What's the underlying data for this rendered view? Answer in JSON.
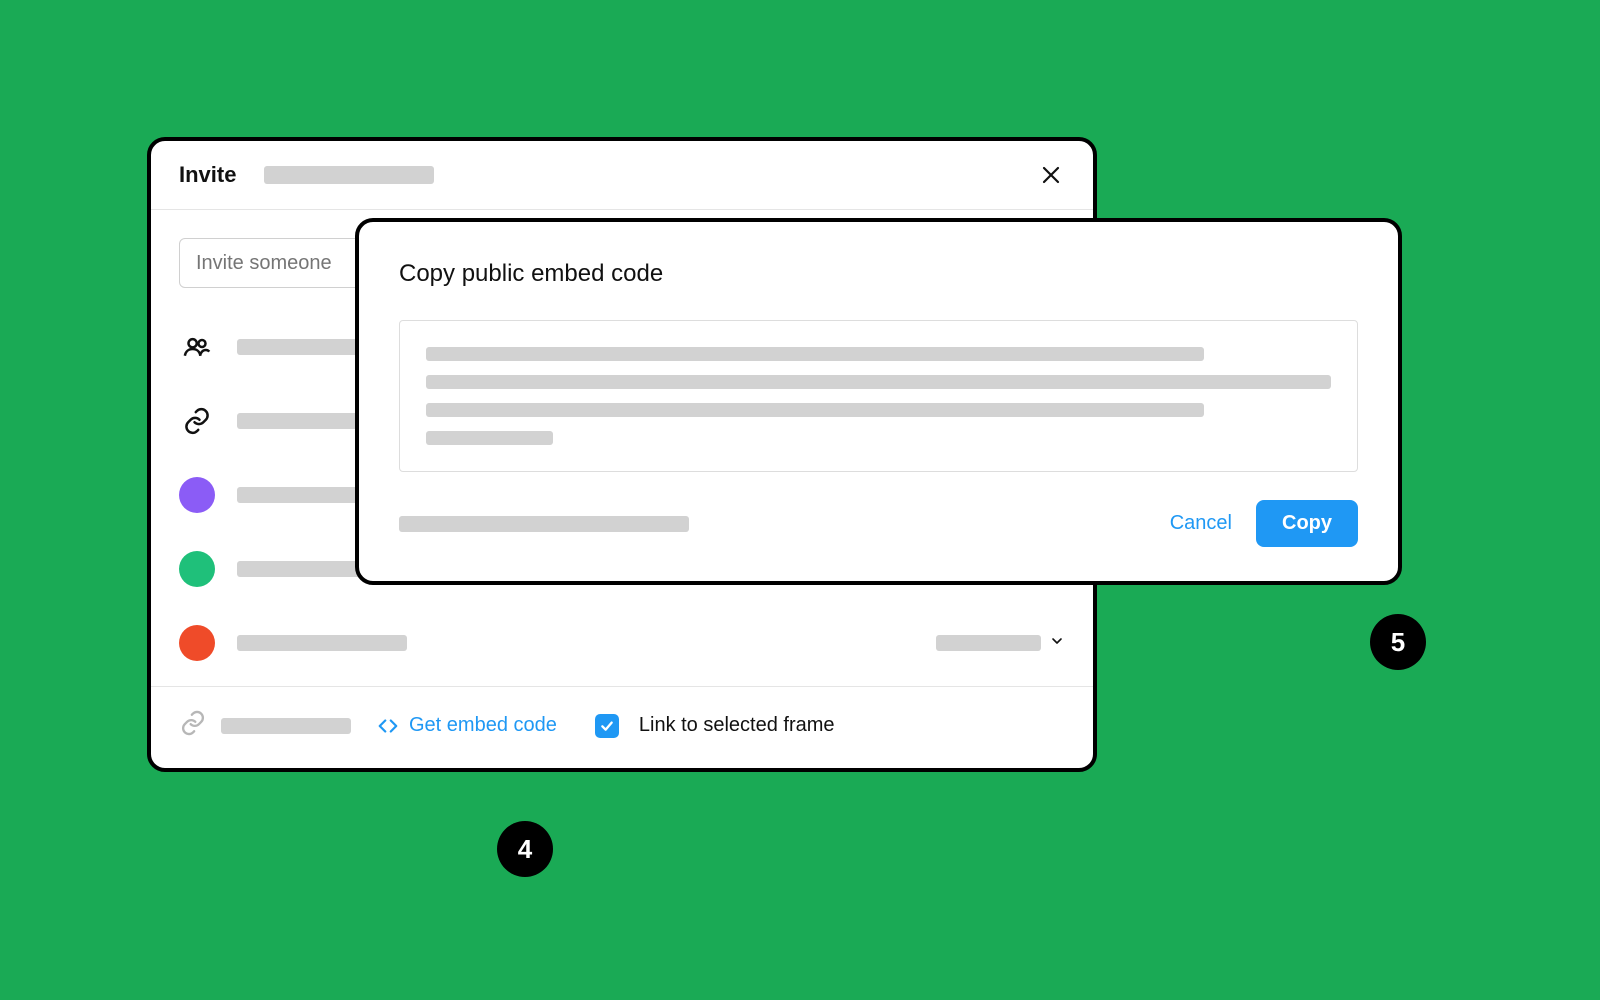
{
  "invite": {
    "title": "Invite",
    "input_placeholder": "Invite someone"
  },
  "users": [
    {
      "color": "#8b5cf6"
    },
    {
      "color": "#10b981"
    },
    {
      "color": "#ef4b29"
    }
  ],
  "footer": {
    "embed_link_label": "Get embed code",
    "checkbox_label": "Link to selected frame"
  },
  "embed_dialog": {
    "title": "Copy public embed code",
    "cancel_label": "Cancel",
    "copy_label": "Copy"
  },
  "annotations": {
    "badge4": "4",
    "badge5": "5"
  }
}
